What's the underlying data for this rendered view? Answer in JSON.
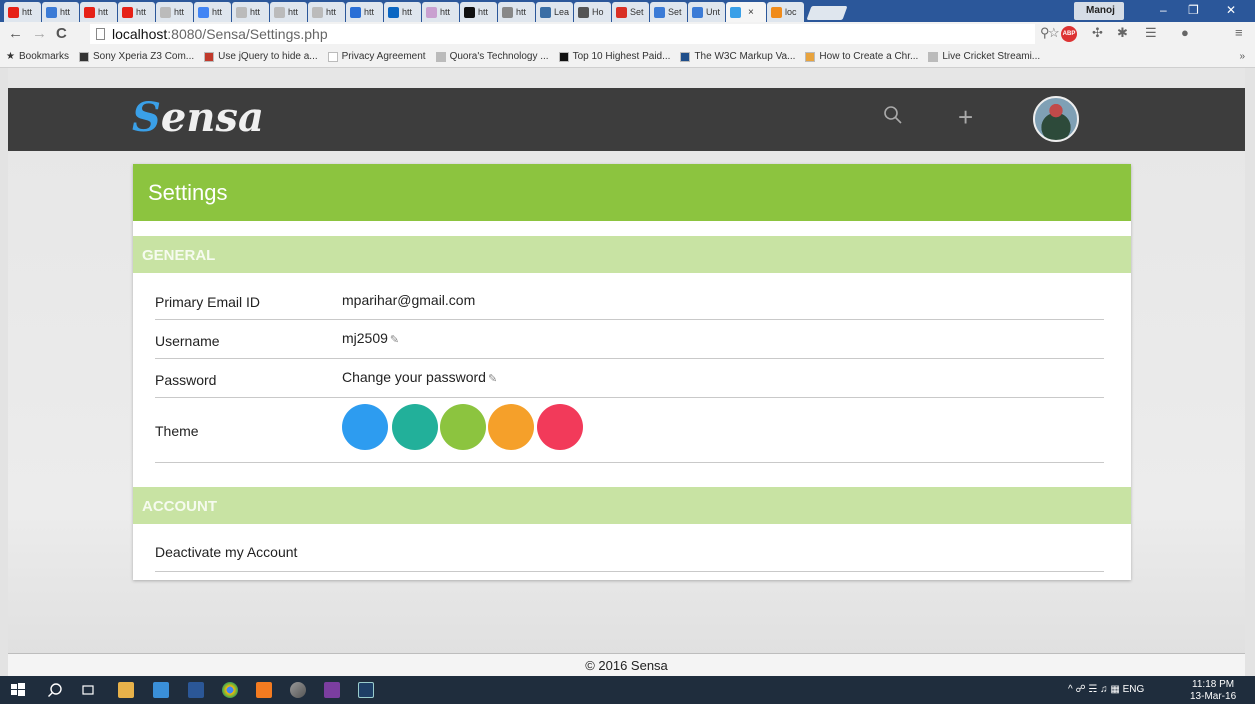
{
  "browser": {
    "tabs": [
      {
        "label": "htt",
        "icon": "youtube-icon",
        "color": "#e62117"
      },
      {
        "label": "htt",
        "icon": "doc-icon",
        "color": "#3b7bd6"
      },
      {
        "label": "htt",
        "icon": "youtube-icon",
        "color": "#e62117"
      },
      {
        "label": "htt",
        "icon": "youtube-icon",
        "color": "#e62117"
      },
      {
        "label": "htt",
        "icon": "page-icon",
        "color": "#bbbbbb"
      },
      {
        "label": "htt",
        "icon": "google-icon",
        "color": "#4285f4"
      },
      {
        "label": "htt",
        "icon": "page-icon",
        "color": "#bbbbbb"
      },
      {
        "label": "htt",
        "icon": "page-icon",
        "color": "#bbbbbb"
      },
      {
        "label": "htt",
        "icon": "page-icon",
        "color": "#bbbbbb"
      },
      {
        "label": "htt",
        "icon": "infinity-icon",
        "color": "#2a6fd6"
      },
      {
        "label": "htt",
        "icon": "linkedin-icon",
        "color": "#0a66c2"
      },
      {
        "label": "htt",
        "icon": "sh-icon",
        "color": "#c9a0d0"
      },
      {
        "label": "htt",
        "icon": "circle-icon",
        "color": "#111111"
      },
      {
        "label": "htt",
        "icon": "bird-icon",
        "color": "#888888"
      },
      {
        "label": "Lea",
        "icon": "image-icon",
        "color": "#3a6ea5"
      },
      {
        "label": "Ho",
        "icon": "person-icon",
        "color": "#555555"
      },
      {
        "label": "Set",
        "icon": "gmail-icon",
        "color": "#d93025"
      },
      {
        "label": "Set",
        "icon": "doc-icon",
        "color": "#3b7bd6"
      },
      {
        "label": "Unt",
        "icon": "doc-icon",
        "color": "#3b7bd6"
      },
      {
        "label": "",
        "icon": "sensa-icon",
        "color": "#3aa0e8"
      },
      {
        "label": "loc",
        "icon": "xampp-icon",
        "color": "#f08c1c"
      }
    ],
    "active_tab_close": "×",
    "user": "Manoj",
    "window_controls": {
      "minimize": "–",
      "restore": "❐",
      "close": "✕"
    },
    "url_host": "localhost",
    "url_path": ":8080/Sensa/Settings.php",
    "abp_label": "ABP",
    "bookmarks_label": "Bookmarks",
    "bookmarks": [
      {
        "label": "Sony Xperia Z3 Com...",
        "color": "#333333"
      },
      {
        "label": "Use jQuery to hide a...",
        "color": "#c0392b"
      },
      {
        "label": "Privacy Agreement",
        "color": "#ffffff"
      },
      {
        "label": "Quora's Technology ...",
        "color": "#bbbbbb"
      },
      {
        "label": "Top 10 Highest Paid...",
        "color": "#111111"
      },
      {
        "label": "The W3C Markup Va...",
        "color": "#1f4e8a"
      },
      {
        "label": "How to Create a Chr...",
        "color": "#e8a33d"
      },
      {
        "label": "Live Cricket Streami...",
        "color": "#bbbbbb"
      }
    ],
    "bookmarks_more": "»"
  },
  "app": {
    "logo_first": "S",
    "logo_rest": "ensa",
    "accent": "#8cc43f",
    "accent_light": "#c8e3a3",
    "header_bg": "#3d3d3d"
  },
  "settings": {
    "title": "Settings",
    "general": {
      "heading": "GENERAL",
      "email_label": "Primary Email ID",
      "email_value": "mparihar@gmail.com",
      "username_label": "Username",
      "username_value": "mj2509",
      "password_label": "Password",
      "password_value": "Change your password",
      "theme_label": "Theme",
      "theme_colors": [
        "#2d9cf0",
        "#22b09a",
        "#8cc43f",
        "#f5a02a",
        "#f23a5a"
      ]
    },
    "account": {
      "heading": "ACCOUNT",
      "deactivate_label": "Deactivate my Account"
    }
  },
  "footer": {
    "text": "© 2016 Sensa"
  },
  "taskbar": {
    "tray_lang": "ENG",
    "time": "11:18 PM",
    "date": "13-Mar-16"
  }
}
